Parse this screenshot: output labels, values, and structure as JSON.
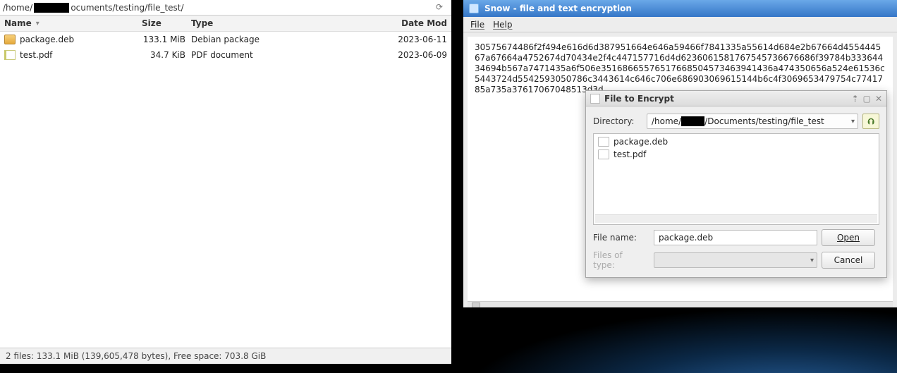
{
  "file_manager": {
    "path_prefix": "/home/",
    "path_suffix": "ocuments/testing/file_test/",
    "columns": {
      "name": "Name",
      "size": "Size",
      "type": "Type",
      "date": "Date Mod"
    },
    "rows": [
      {
        "name": "package.deb",
        "size": "133.1 MiB",
        "type": "Debian package",
        "date": "2023-06-11",
        "icon": "deb"
      },
      {
        "name": "test.pdf",
        "size": "34.7 KiB",
        "type": "PDF document",
        "date": "2023-06-09",
        "icon": "pdf"
      }
    ],
    "status": "2 files: 133.1 MiB (139,605,478 bytes), Free space: 703.8 GiB"
  },
  "snow": {
    "title": "Snow - file and text encryption",
    "menu": {
      "file": "File",
      "help": "Help"
    },
    "hex": "30575674486f2f494e616d6d387951664e646a59466f7841335a55614d684e2b67664d455444567a67664a4752674d70434e2f4c447157716d4d6236061581767545736676686f39784b33364434694b567a7471435a6f506e35168665576517668504573463941436a474350656a524e61536c5443724d5542593050786c3443614c646c706e686903069615144b6c4f3069653479754c7741785a735a37617067048513d3d"
  },
  "dialog": {
    "title": "File to Encrypt",
    "labels": {
      "directory": "Directory:",
      "filename": "File name:",
      "filetype": "Files of type:"
    },
    "dir_prefix": "/home/",
    "dir_suffix": "/Documents/testing/file_test",
    "files": [
      {
        "name": "package.deb"
      },
      {
        "name": "test.pdf"
      }
    ],
    "filename_value": "package.deb",
    "buttons": {
      "open": "Open",
      "cancel": "Cancel"
    }
  }
}
